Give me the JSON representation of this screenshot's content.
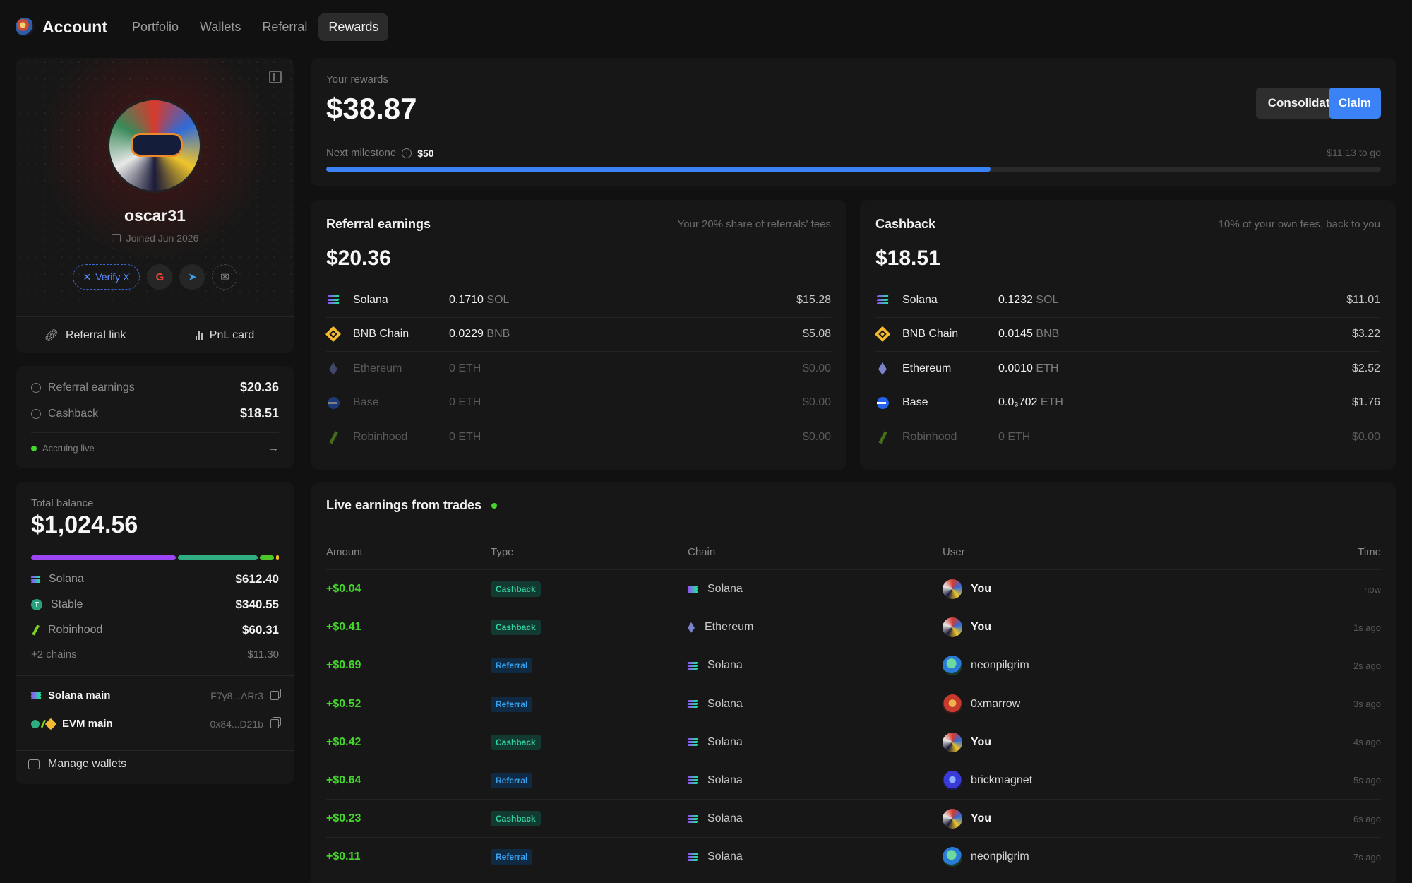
{
  "nav": {
    "brand": "Account",
    "tabs": [
      {
        "label": "Portfolio"
      },
      {
        "label": "Wallets"
      },
      {
        "label": "Referral"
      },
      {
        "label": "Rewards"
      }
    ],
    "active_tab": "Rewards"
  },
  "profile": {
    "username": "oscar31",
    "joined": "Joined Jun 2026",
    "verify_label": "Verify X",
    "google_glyph": "G",
    "telegram_glyph": "➤",
    "mail_glyph": "✉",
    "referral_link_label": "Referral link",
    "pnl_card_label": "PnL card"
  },
  "summary": {
    "referral_label": "Referral earnings",
    "referral_value": "$20.36",
    "cashback_label": "Cashback",
    "cashback_value": "$18.51",
    "accruing_label": "Accruing live",
    "arrow_glyph": "→"
  },
  "balance": {
    "label": "Total balance",
    "value": "$1,024.56",
    "allocation": [
      {
        "name": "Solana",
        "fraction": 0.598,
        "color": "#9b45f5"
      },
      {
        "name": "Stable",
        "fraction": 0.332,
        "color": "#2fae82"
      },
      {
        "name": "Robinhood",
        "fraction": 0.059,
        "color": "#4cc72a"
      },
      {
        "name": "+2 chains",
        "fraction": 0.011,
        "color": "#f3ba2f"
      }
    ],
    "chains": [
      {
        "name": "Solana",
        "value": "$612.40",
        "icon": "solana-icon"
      },
      {
        "name": "Stable",
        "value": "$340.55",
        "icon": "stable-icon"
      },
      {
        "name": "Robinhood",
        "value": "$60.31",
        "icon": "robinhood-icon"
      }
    ],
    "more_label": "+2 chains",
    "more_value": "$11.30",
    "wallets": [
      {
        "name": "Solana main",
        "address": "F7y8...ARr3"
      },
      {
        "name": "EVM main",
        "address": "0x84...D21b"
      }
    ],
    "manage_label": "Manage wallets"
  },
  "rewards": {
    "label": "Your rewards",
    "value": "$38.87",
    "consolidate_label": "Consolidate",
    "claim_label": "Claim",
    "milestone_label": "Next milestone",
    "milestone_value": "$50",
    "to_go": "$11.13 to go",
    "progress_fraction": 0.63,
    "info_glyph": "i"
  },
  "referral_earnings": {
    "title": "Referral earnings",
    "description": "Your 20% share of referrals' fees",
    "total": "$20.36",
    "rows": [
      {
        "chain": "Solana",
        "amount": "0.1710",
        "unit": "SOL",
        "usd": "$15.28",
        "zero": false
      },
      {
        "chain": "BNB Chain",
        "amount": "0.0229",
        "unit": "BNB",
        "usd": "$5.08",
        "zero": false
      },
      {
        "chain": "Ethereum",
        "amount": "0",
        "unit": "ETH",
        "usd": "$0.00",
        "zero": true
      },
      {
        "chain": "Base",
        "amount": "0",
        "unit": "ETH",
        "usd": "$0.00",
        "zero": true
      },
      {
        "chain": "Robinhood",
        "amount": "0",
        "unit": "ETH",
        "usd": "$0.00",
        "zero": true
      }
    ]
  },
  "cashback": {
    "title": "Cashback",
    "description": "10% of your own fees, back to you",
    "total": "$18.51",
    "rows": [
      {
        "chain": "Solana",
        "amount": "0.1232",
        "unit": "SOL",
        "usd": "$11.01",
        "zero": false,
        "highlight": true
      },
      {
        "chain": "BNB Chain",
        "amount": "0.0145",
        "unit": "BNB",
        "usd": "$3.22",
        "zero": false
      },
      {
        "chain": "Ethereum",
        "amount": "0.0010",
        "unit": "ETH",
        "usd": "$2.52",
        "zero": false
      },
      {
        "chain": "Base",
        "amount": "0.0₃702",
        "unit": "ETH",
        "usd": "$1.76",
        "zero": false
      },
      {
        "chain": "Robinhood",
        "amount": "0",
        "unit": "ETH",
        "usd": "$0.00",
        "zero": true
      }
    ]
  },
  "live_trades": {
    "title": "Live earnings from trades",
    "columns": {
      "amount": "Amount",
      "type": "Type",
      "chain": "Chain",
      "user": "User",
      "time": "Time"
    },
    "rows": [
      {
        "amount": "+$0.04",
        "type": "Cashback",
        "chain": "Solana",
        "user": "You",
        "time": "now"
      },
      {
        "amount": "+$0.41",
        "type": "Cashback",
        "chain": "Ethereum",
        "user": "You",
        "time": "1s ago"
      },
      {
        "amount": "+$0.69",
        "type": "Referral",
        "chain": "Solana",
        "user": "neonpilgrim",
        "time": "2s ago"
      },
      {
        "amount": "+$0.52",
        "type": "Referral",
        "chain": "Solana",
        "user": "0xmarrow",
        "time": "3s ago"
      },
      {
        "amount": "+$0.42",
        "type": "Cashback",
        "chain": "Solana",
        "user": "You",
        "time": "4s ago"
      },
      {
        "amount": "+$0.64",
        "type": "Referral",
        "chain": "Solana",
        "user": "brickmagnet",
        "time": "5s ago"
      },
      {
        "amount": "+$0.23",
        "type": "Cashback",
        "chain": "Solana",
        "user": "You",
        "time": "6s ago"
      },
      {
        "amount": "+$0.11",
        "type": "Referral",
        "chain": "Solana",
        "user": "neonpilgrim",
        "time": "7s ago"
      }
    ]
  },
  "colors": {
    "accent": "#3b82f6",
    "positive": "#44d62c",
    "cashback_badge": "#34d0a0",
    "referral_badge": "#3aa0ea"
  }
}
